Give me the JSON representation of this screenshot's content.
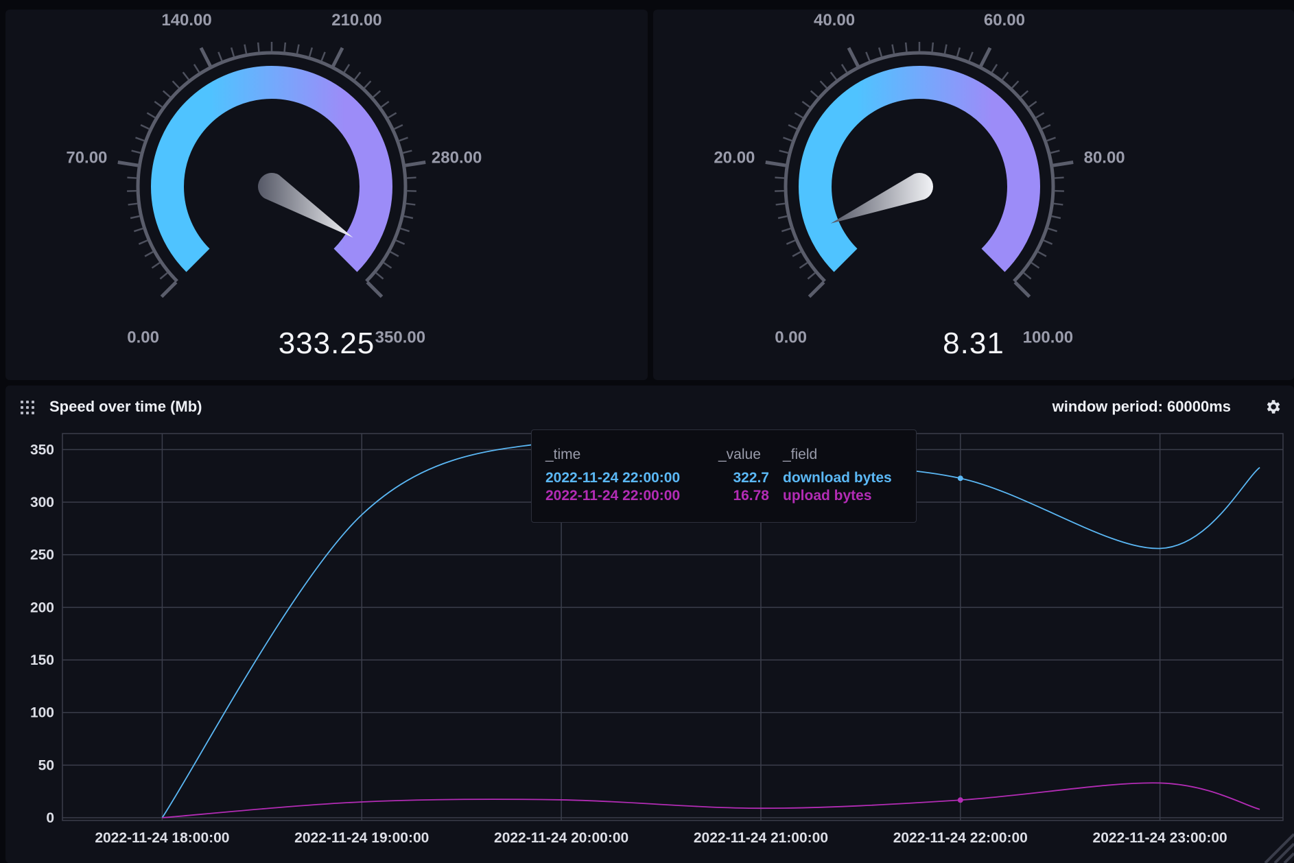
{
  "gauges": [
    {
      "min": 0,
      "max": 350,
      "value": 333.25,
      "value_label": "333.25",
      "tick_labels": [
        "0.00",
        "70.00",
        "140.00",
        "210.00",
        "280.00",
        "350.00"
      ],
      "colors": [
        "#4fc3ff",
        "#9c8cf8"
      ]
    },
    {
      "min": 0,
      "max": 100,
      "value": 8.31,
      "value_label": "8.31",
      "tick_labels": [
        "0.00",
        "20.00",
        "40.00",
        "60.00",
        "80.00",
        "100.00"
      ],
      "colors": [
        "#4fc3ff",
        "#9c8cf8"
      ]
    }
  ],
  "graph": {
    "title": "Speed over time (Mb)",
    "window_period": "window period: 60000ms",
    "settings_icon": "gear-icon",
    "drag_icon": "drag-handle-icon"
  },
  "tooltip": {
    "headers": [
      "_time",
      "_value",
      "_field"
    ],
    "rows": [
      {
        "time": "2022-11-24 22:00:00",
        "value": "322.7",
        "field": "download bytes",
        "color": "#5bb8f5"
      },
      {
        "time": "2022-11-24 22:00:00",
        "value": "16.78",
        "field": "upload bytes",
        "color": "#b32cb5"
      }
    ]
  },
  "chart_data": {
    "type": "line",
    "x": [
      "2022-11-24 18:00:00",
      "2022-11-24 19:00:00",
      "2022-11-24 20:00:00",
      "2022-11-24 21:00:00",
      "2022-11-24 22:00:00",
      "2022-11-24 23:00:00",
      "2022-11-24 23:30:00"
    ],
    "x_tick_labels": [
      "2022-11-24 18:00:00",
      "2022-11-24 19:00:00",
      "2022-11-24 20:00:00",
      "2022-11-24 21:00:00",
      "2022-11-24 22:00:00",
      "2022-11-24 23:00:00"
    ],
    "y_tick_labels": [
      "0",
      "50",
      "100",
      "150",
      "200",
      "250",
      "300",
      "350"
    ],
    "ylim": [
      0,
      360
    ],
    "grid": true,
    "series": [
      {
        "name": "download bytes",
        "color": "#5bb8f5",
        "values": [
          0,
          288,
          358,
          338,
          322.7,
          256,
          333
        ]
      },
      {
        "name": "upload bytes",
        "color": "#b32cb5",
        "values": [
          0,
          15,
          17,
          9,
          16.78,
          33,
          8
        ]
      }
    ],
    "highlight_x": "2022-11-24 22:00:00"
  }
}
